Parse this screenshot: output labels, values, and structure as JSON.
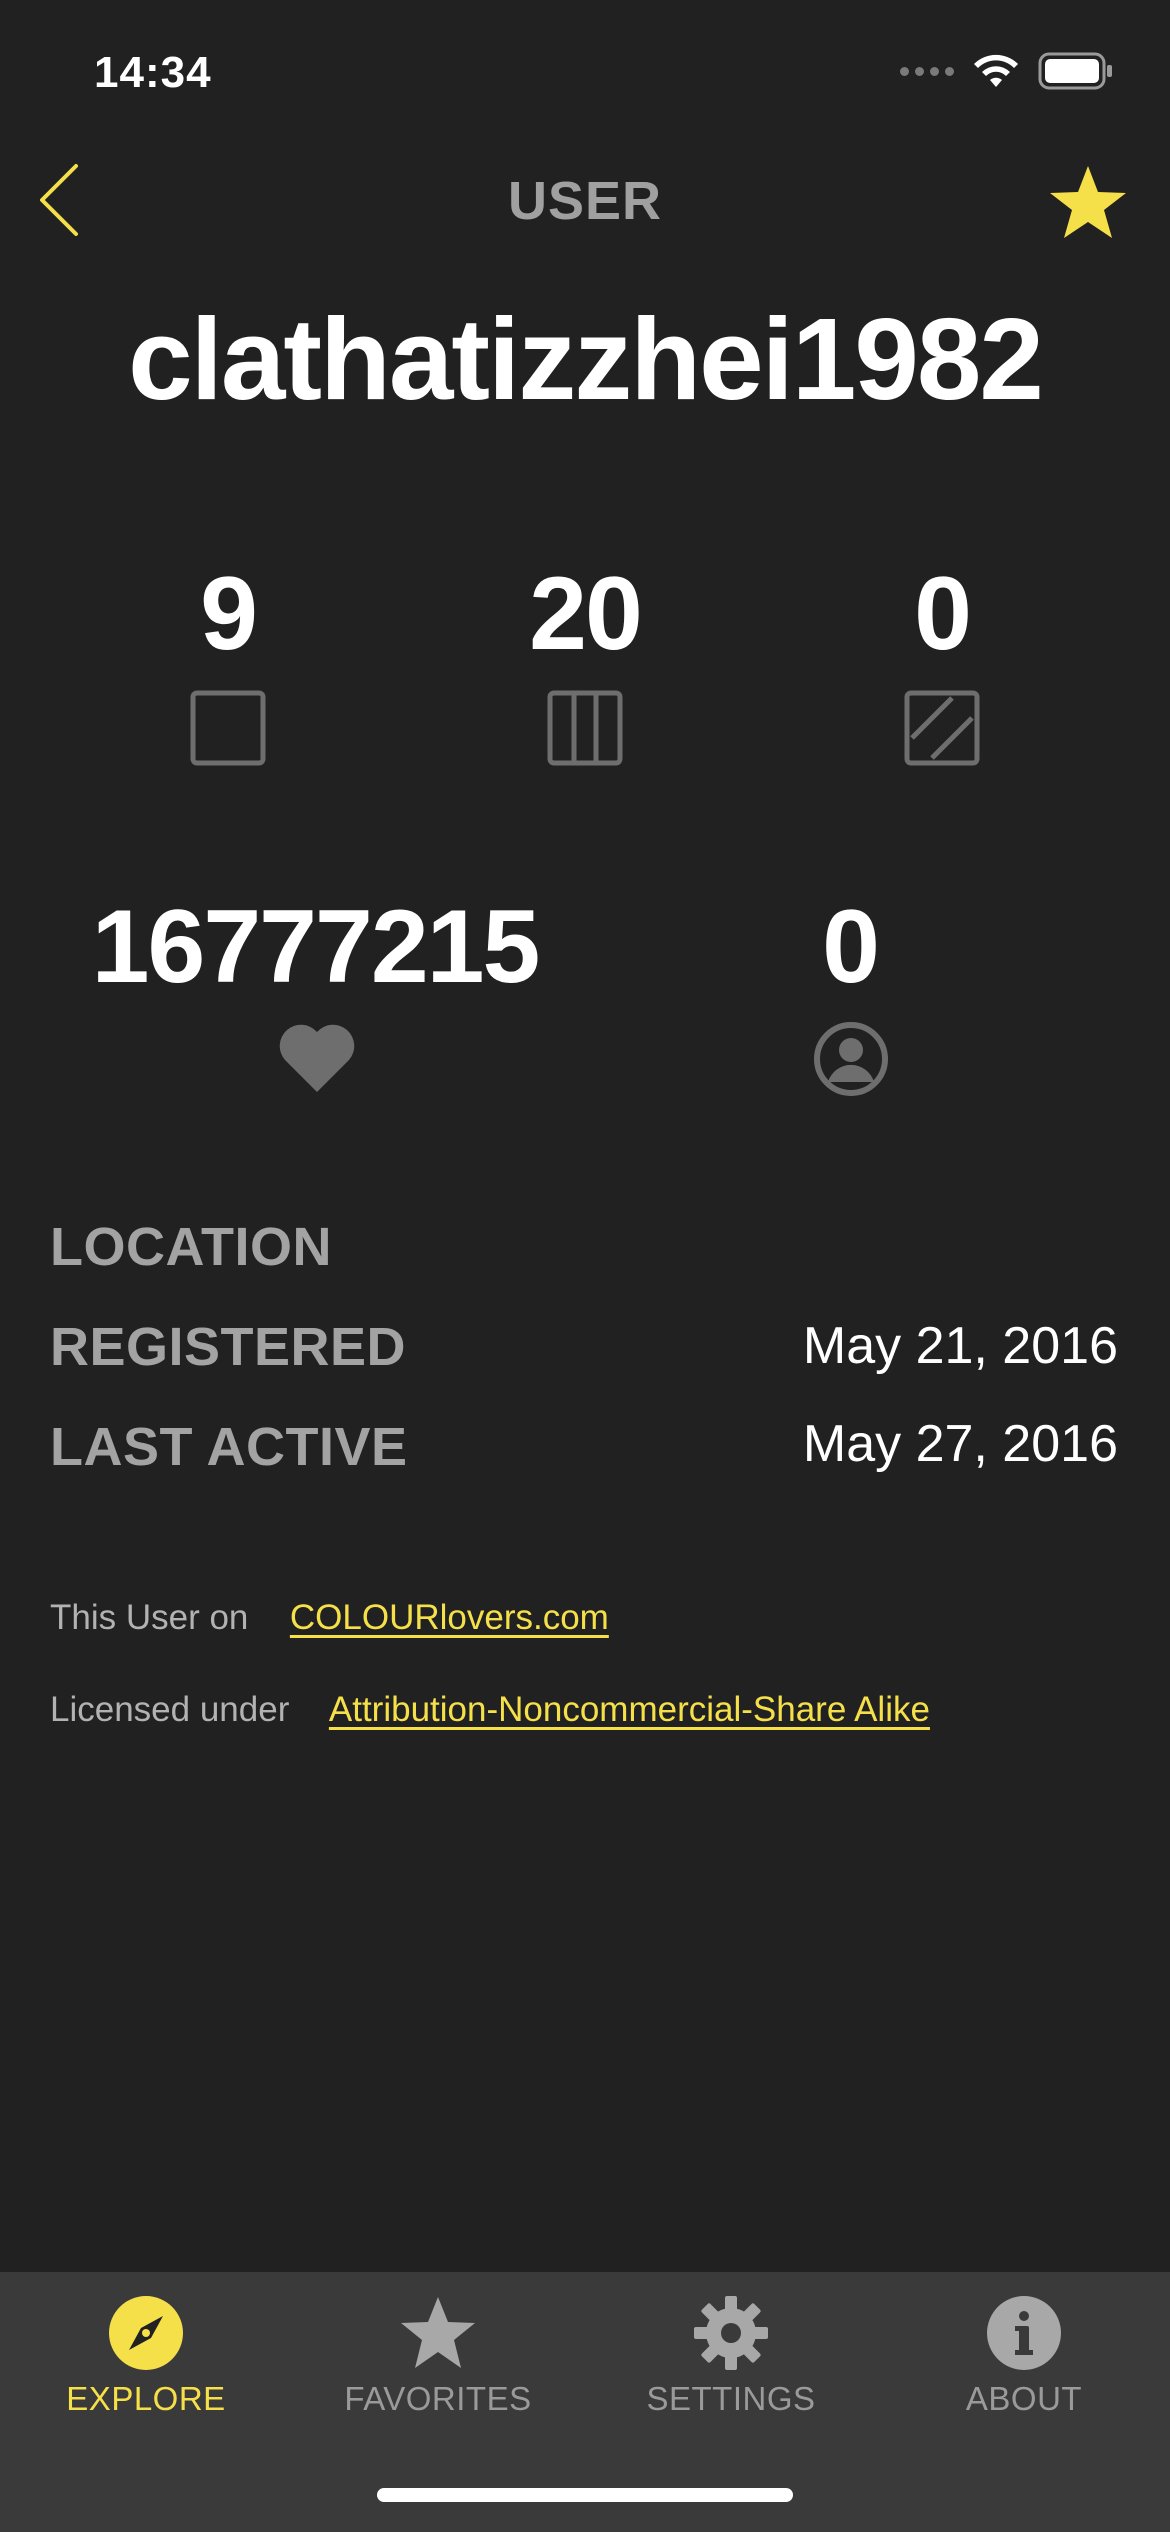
{
  "status_bar": {
    "time": "14:34"
  },
  "nav": {
    "title": "USER"
  },
  "user": {
    "name": "clathatizzhei1982"
  },
  "stats_row1": [
    {
      "value": "9",
      "icon": "color-square-icon"
    },
    {
      "value": "20",
      "icon": "palette-columns-icon"
    },
    {
      "value": "0",
      "icon": "pattern-hatch-icon"
    }
  ],
  "stats_row2": [
    {
      "value": "16777215",
      "icon": "heart-icon"
    },
    {
      "value": "0",
      "icon": "user-circle-icon"
    }
  ],
  "info": {
    "location_label": "LOCATION",
    "location_value": "",
    "registered_label": "REGISTERED",
    "registered_value": "May 21, 2016",
    "last_active_label": "LAST ACTIVE",
    "last_active_value": "May 27, 2016"
  },
  "footer": {
    "user_on_text": "This User on",
    "user_on_link": "COLOURlovers.com",
    "licensed_text": "Licensed under",
    "licensed_link": "Attribution-Noncommercial-Share Alike"
  },
  "tabs": [
    {
      "label": "EXPLORE",
      "icon": "compass-icon",
      "active": true
    },
    {
      "label": "FAVORITES",
      "icon": "star-icon",
      "active": false
    },
    {
      "label": "SETTINGS",
      "icon": "gear-icon",
      "active": false
    },
    {
      "label": "ABOUT",
      "icon": "info-icon",
      "active": false
    }
  ],
  "colors": {
    "accent": "#f5e04a",
    "background": "#212121",
    "tabbar": "#3a3a3a"
  }
}
